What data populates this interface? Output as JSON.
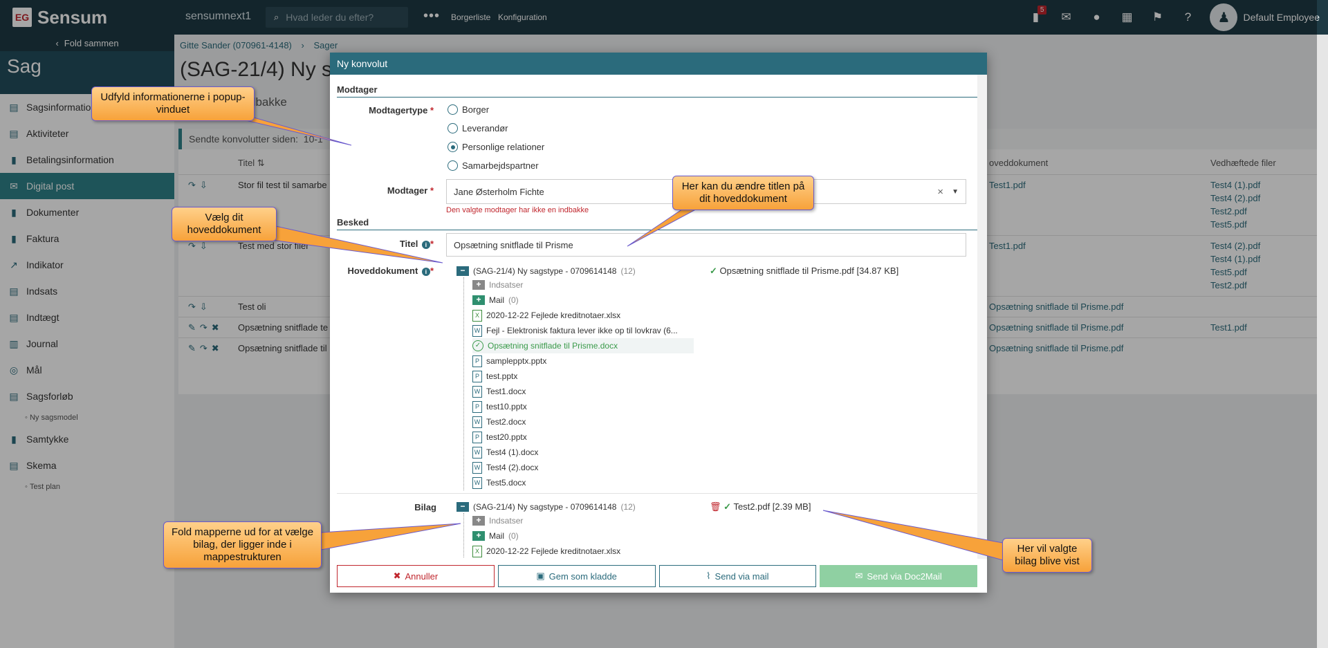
{
  "topbar": {
    "logo_mark": "EG",
    "logo_text": "Sensum",
    "tenant": "sensumnext1",
    "search_placeholder": "Hvad leder du efter?",
    "more": "•••",
    "nav": [
      "Borgerliste",
      "Konfiguration"
    ],
    "notification_count": "5",
    "user_name": "Default Employee"
  },
  "sidebar": {
    "fold_label": "Fold sammen",
    "section_title": "Sag",
    "items": [
      {
        "label": "Sagsinformation",
        "icon": "case-info-icon"
      },
      {
        "label": "Aktiviteter",
        "icon": "activities-icon"
      },
      {
        "label": "Betalingsinformation",
        "icon": "payment-icon"
      },
      {
        "label": "Digital post",
        "icon": "mail-icon",
        "active": true
      },
      {
        "label": "Dokumenter",
        "icon": "documents-icon"
      },
      {
        "label": "Faktura",
        "icon": "invoice-icon"
      },
      {
        "label": "Indikator",
        "icon": "indicator-icon"
      },
      {
        "label": "Indsats",
        "icon": "effort-icon"
      },
      {
        "label": "Indtægt",
        "icon": "income-icon"
      },
      {
        "label": "Journal",
        "icon": "journal-icon"
      },
      {
        "label": "Mål",
        "icon": "goal-icon"
      },
      {
        "label": "Sagsforløb",
        "icon": "case-flow-icon"
      }
    ],
    "sub_sagsforlob": "Ny sagsmodel",
    "items2": [
      {
        "label": "Samtykke",
        "icon": "consent-icon"
      },
      {
        "label": "Skema",
        "icon": "form-icon"
      }
    ],
    "sub_skema": "Test plan"
  },
  "main": {
    "breadcrumb": [
      "Gitte Sander (070961-4148)",
      "Sager"
    ],
    "title": "(SAG-21/4) Ny s",
    "subtab": "dbakke",
    "panel_title": "Sendte konvolutter siden:",
    "panel_title_suffix": "10-1",
    "col_title": "Titel",
    "col_main": "oveddokument",
    "col_attach": "Vedhæftede filer",
    "rows": [
      {
        "title": "Stor fil test til samarbe",
        "main": "Test1.pdf",
        "attach": [
          "Test4 (1).pdf",
          "Test4 (2).pdf",
          "Test2.pdf",
          "Test5.pdf"
        ]
      },
      {
        "title": "Test med stor filer",
        "main": "Test1.pdf",
        "attach": [
          "Test4 (2).pdf",
          "Test4 (1).pdf",
          "Test5.pdf",
          "Test2.pdf"
        ]
      },
      {
        "title": "Test oli",
        "main": "Opsætning snitflade til Prisme.pdf",
        "attach": []
      },
      {
        "title": "Opsætning snitflade te",
        "main": "Opsætning snitflade til Prisme.pdf",
        "attach": [
          "Test1.pdf"
        ]
      },
      {
        "title": "Opsætning snitflade til",
        "main": "Opsætning snitflade til Prisme.pdf",
        "attach": []
      }
    ]
  },
  "modal": {
    "title": "Ny konvolut",
    "section_recipient": "Modtager",
    "label_recipient_type": "Modtagertype",
    "recipient_types": [
      "Borger",
      "Leverandør",
      "Personlige relationer",
      "Samarbejdspartner"
    ],
    "selected_type": "Personlige relationer",
    "label_recipient": "Modtager",
    "recipient_value": "Jane Østerholm Fichte",
    "recipient_error": "Den valgte modtager har ikke en indbakke",
    "section_message": "Besked",
    "label_title": "Titel",
    "title_value": "Opsætning snitflade til Prisme",
    "label_main_doc": "Hoveddokument",
    "label_attach": "Bilag",
    "tree_root": "(SAG-21/4) Ny sagstype - 0709614148",
    "tree_count": "(12)",
    "folders": [
      {
        "name": "Indsatser",
        "count": ""
      },
      {
        "name": "Mail",
        "count": "(0)"
      }
    ],
    "files": [
      {
        "name": "2020-12-22 Fejlede kreditnotaer.xlsx",
        "type": "X"
      },
      {
        "name": "Fejl - Elektronisk faktura lever ikke op til lovkrav (6...",
        "type": "W"
      },
      {
        "name": "Opsætning snitflade til Prisme.docx",
        "type": "W",
        "selected": true
      },
      {
        "name": "samplepptx.pptx",
        "type": "P"
      },
      {
        "name": "test.pptx",
        "type": "P"
      },
      {
        "name": "Test1.docx",
        "type": "W"
      },
      {
        "name": "test10.pptx",
        "type": "P"
      },
      {
        "name": "Test2.docx",
        "type": "W"
      },
      {
        "name": "test20.pptx",
        "type": "P"
      },
      {
        "name": "Test4 (1).docx",
        "type": "W"
      },
      {
        "name": "Test4 (2).docx",
        "type": "W"
      },
      {
        "name": "Test5.docx",
        "type": "W"
      }
    ],
    "attach_files_visible": [
      {
        "name": "2020-12-22 Fejlede kreditnotaer.xlsx",
        "type": "X"
      }
    ],
    "selected_main": "Opsætning snitflade til Prisme.pdf [34.87 KB]",
    "selected_attach": "Test2.pdf [2.39 MB]",
    "buttons": {
      "cancel": "Annuller",
      "draft": "Gem som kladde",
      "mail": "Send via mail",
      "doc2mail": "Send via Doc2Mail"
    }
  },
  "callouts": {
    "fill_info": "Udfyld informationerne i popup-vinduet",
    "change_title": "Her kan du ændre titlen på dit hoveddokument",
    "choose_main": "Vælg dit hoveddokument",
    "expand_folders": "Fold mapperne ud for at vælge bilag, der ligger inde i mappestrukturen",
    "attach_shown": "Her vil valgte bilag blive vist"
  },
  "colors": {
    "topbar": "#1e3a44",
    "accent": "#2b6b7c",
    "active_nav": "#2f8289",
    "required": "#c0262d",
    "success": "#3a9a4a",
    "callout": "#f7a23a"
  }
}
